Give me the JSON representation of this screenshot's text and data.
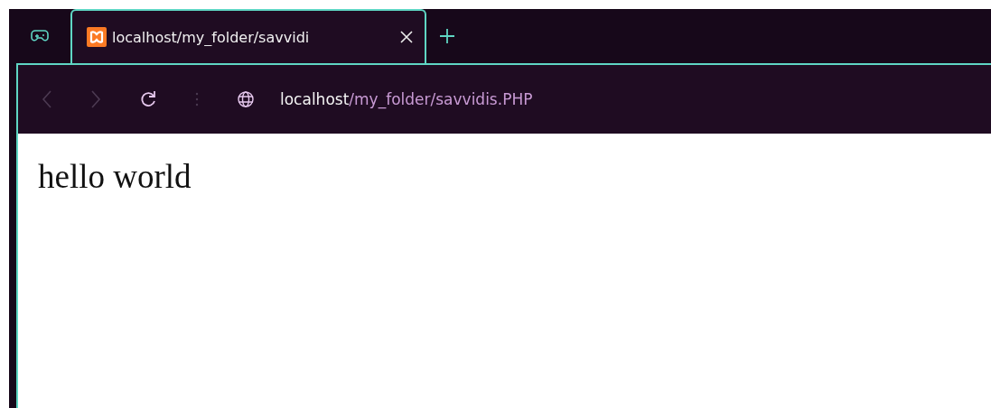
{
  "tabs": [
    {
      "kind": "group",
      "selected": false
    },
    {
      "kind": "page",
      "title": "localhost/my_folder/savvidi",
      "selected": true
    }
  ],
  "toolbar": {
    "back": {
      "disabled": true
    },
    "forward": {
      "disabled": true
    },
    "address": {
      "host": "localhost",
      "path": "/my_folder/savvidis.PHP"
    }
  },
  "page": {
    "text": "hello world"
  }
}
